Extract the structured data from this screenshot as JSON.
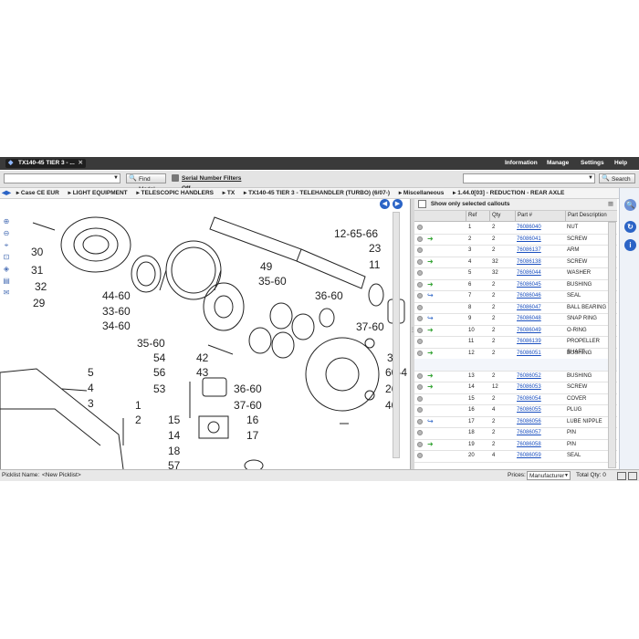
{
  "topbar": {
    "tab_title": "TX140-45 TIER 3 - ...",
    "nav": [
      "Information",
      "Manage",
      "Settings",
      "Help"
    ]
  },
  "toolbar": {
    "find_model": "Find Model",
    "serial_filters": "Serial Number Filters Off",
    "search_button": "Search"
  },
  "breadcrumb": [
    "Case CE EUR",
    "LIGHT EQUIPMENT",
    "TELESCOPIC HANDLERS",
    "TX",
    "TX140-45 TIER 3 - TELEHANDLER (TURBO) (6/07-)",
    "Miscellaneous",
    "1.44.0[03] - REDUCTION - REAR AXLE"
  ],
  "diagram": {
    "callouts": [
      "30",
      "31",
      "32",
      "29",
      "44-60",
      "33-60",
      "34-60",
      "49",
      "35-60",
      "36-60",
      "12-65-66",
      "23",
      "11",
      "37-60",
      "35-60",
      "54",
      "56",
      "53",
      "42",
      "43",
      "38",
      "60-4",
      "26",
      "40",
      "36-60",
      "37-60",
      "5",
      "4",
      "3",
      "1",
      "2",
      "15",
      "16",
      "14",
      "17",
      "18",
      "57"
    ]
  },
  "parts": {
    "show_selected_label": "Show only selected callouts",
    "columns": [
      "Ref",
      "Qty",
      "Part #",
      "Part Description"
    ],
    "rows": [
      {
        "ref": "1",
        "qty": "2",
        "part": "76086040",
        "desc": "NUT",
        "action": "none"
      },
      {
        "ref": "2",
        "qty": "2",
        "part": "76086041",
        "desc": "SCREW",
        "action": "green"
      },
      {
        "ref": "3",
        "qty": "2",
        "part": "76086137",
        "desc": "ARM",
        "action": "none"
      },
      {
        "ref": "4",
        "qty": "32",
        "part": "76086138",
        "desc": "SCREW",
        "action": "green"
      },
      {
        "ref": "5",
        "qty": "32",
        "part": "76086044",
        "desc": "WASHER",
        "action": "none"
      },
      {
        "ref": "6",
        "qty": "2",
        "part": "76086045",
        "desc": "BUSHING",
        "action": "green"
      },
      {
        "ref": "7",
        "qty": "2",
        "part": "76086046",
        "desc": "SEAL",
        "action": "blue"
      },
      {
        "ref": "8",
        "qty": "2",
        "part": "76086047",
        "desc": "BALL BEARING",
        "action": "none"
      },
      {
        "ref": "9",
        "qty": "2",
        "part": "76086048",
        "desc": "SNAP RING",
        "action": "blue"
      },
      {
        "ref": "10",
        "qty": "2",
        "part": "76086049",
        "desc": "O-RING",
        "action": "green"
      },
      {
        "ref": "11",
        "qty": "2",
        "part": "76086139",
        "desc": "PROPELLER SHAFT",
        "action": "none"
      },
      {
        "ref": "12",
        "qty": "2",
        "part": "76086051",
        "desc": "BUSHING",
        "action": "green"
      },
      {
        "ref": "",
        "qty": "",
        "part": "",
        "desc": "",
        "action": "gap"
      },
      {
        "ref": "13",
        "qty": "2",
        "part": "76086052",
        "desc": "BUSHING",
        "action": "green"
      },
      {
        "ref": "14",
        "qty": "12",
        "part": "76086053",
        "desc": "SCREW",
        "action": "green"
      },
      {
        "ref": "15",
        "qty": "2",
        "part": "76086054",
        "desc": "COVER",
        "action": "none"
      },
      {
        "ref": "16",
        "qty": "4",
        "part": "76086055",
        "desc": "PLUG",
        "action": "none"
      },
      {
        "ref": "17",
        "qty": "2",
        "part": "76086056",
        "desc": "LUBE NIPPLE",
        "action": "blue"
      },
      {
        "ref": "18",
        "qty": "2",
        "part": "76086057",
        "desc": "PIN",
        "action": "none"
      },
      {
        "ref": "19",
        "qty": "2",
        "part": "76086058",
        "desc": "PIN",
        "action": "green"
      },
      {
        "ref": "20",
        "qty": "4",
        "part": "76086059",
        "desc": "SEAL",
        "action": "none"
      }
    ]
  },
  "footer": {
    "picklist_label": "Picklist Name:",
    "picklist_value": "<New Picklist>",
    "prices_label": "Prices:",
    "prices_value": "Manufacturer",
    "total_qty": "Total Qty: 0"
  },
  "colors": {
    "topbar": "#3a3a3a",
    "link": "#1a4fbf",
    "accent_blue": "#2b64c6",
    "green_arrow": "#3aa63a"
  }
}
